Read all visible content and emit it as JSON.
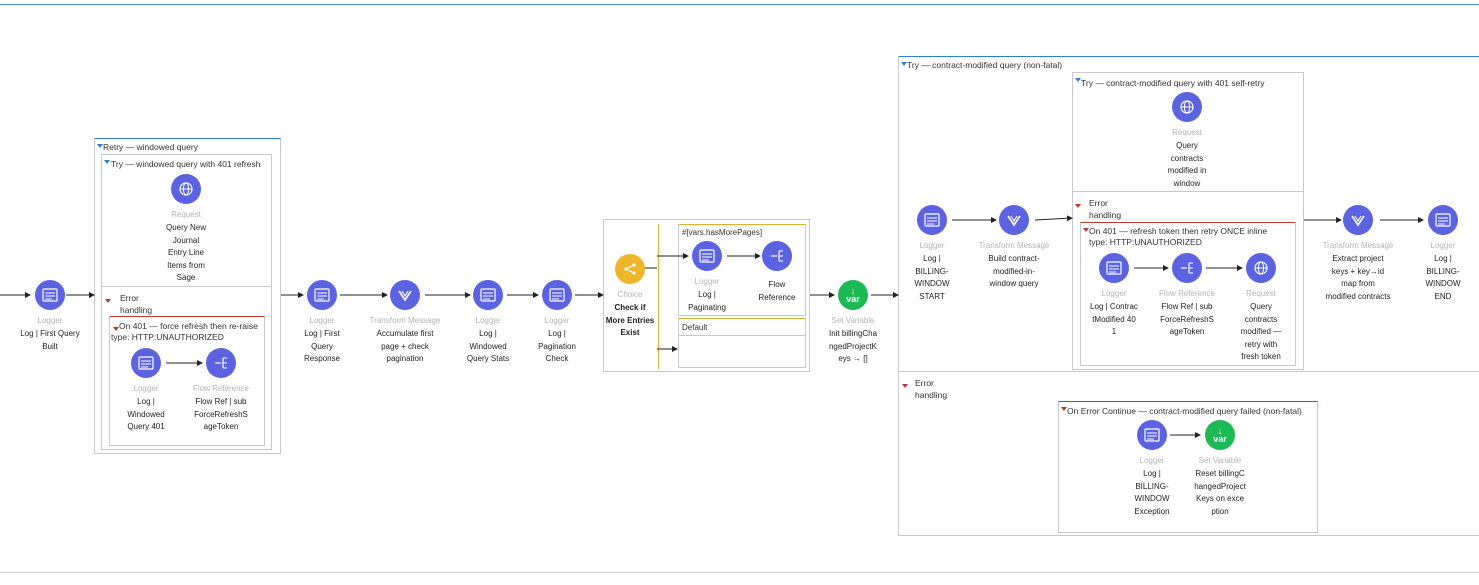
{
  "scopes": {
    "retry": "Retry — windowed query",
    "try_windowed": "Try — windowed query with 401 refresh",
    "error_handling": "Error handling",
    "on401_force": "On 401 — force refresh then re-raise",
    "on401_type": "type: HTTP:UNAUTHORIZED",
    "choice_when": "#[vars.hasMorePages]",
    "choice_default": "Default",
    "try_contract": "Try — contract-modified query (non-fatal)",
    "try_contract_retry": "Try — contract-modified query with 401 self-retry",
    "on401_retry": "On 401 — refresh token then retry ONCE inline",
    "on401_retry_type": "type: HTTP:UNAUTHORIZED",
    "on_error_continue": "On Error Continue — contract-modified query failed (non-fatal)"
  },
  "nodes": {
    "n1": {
      "kind": "Logger",
      "label": "Log | First Query Built"
    },
    "n2": {
      "kind": "Request",
      "label": "Query New Journal Entry Line Items from Sage"
    },
    "n3": {
      "kind": "Logger",
      "label": "Log | Windowed Query 401"
    },
    "n4": {
      "kind": "Flow Reference",
      "label": "Flow Ref | subForceRefreshSageToken"
    },
    "n5": {
      "kind": "Logger",
      "label": "Log | First Query Response"
    },
    "n6": {
      "kind": "Transform Message",
      "label": "Accumulate first page + check pagination"
    },
    "n7": {
      "kind": "Logger",
      "label": "Log | Windowed Query Stats"
    },
    "n8": {
      "kind": "Logger",
      "label": "Log | Pagination Check"
    },
    "n9": {
      "kind": "Choice",
      "label": "Check if More Entries Exist"
    },
    "n10": {
      "kind": "Logger",
      "label": "Log | Paginating"
    },
    "n11": {
      "kind": "",
      "label": "Flow Reference"
    },
    "n12": {
      "kind": "Set Variable",
      "label": "Init billingChangedProjectKeys → []",
      "icon": "var"
    },
    "n13": {
      "kind": "Logger",
      "label": "Log | BILLING-WINDOW START"
    },
    "n14": {
      "kind": "Transform Message",
      "label": "Build contract-modified-in-window query"
    },
    "n15": {
      "kind": "Request",
      "label": "Query contracts modified in window"
    },
    "n16": {
      "kind": "Logger",
      "label": "Log | ContractModified 401"
    },
    "n17": {
      "kind": "Flow Reference",
      "label": "Flow Ref | subForceRefreshSageToken"
    },
    "n18": {
      "kind": "Request",
      "label": "Query contracts modified — retry with fresh token"
    },
    "n19": {
      "kind": "Logger",
      "label": "Log | BILLING-WINDOW Exception"
    },
    "n20": {
      "kind": "Set Variable",
      "label": "Reset billingChangedProjectKeys on exception",
      "icon": "var"
    },
    "n21": {
      "kind": "Transform Message",
      "label": "Extract project keys + key→id map from modified contracts"
    },
    "n22": {
      "kind": "Logger",
      "label": "Log | BILLING-WINDOW END"
    }
  },
  "colors": {
    "accent": "#5b63e0",
    "variable": "#1db954",
    "choice": "#f0b62a",
    "scope_blue": "#2d7fd1",
    "error_red": "#c0392b"
  }
}
